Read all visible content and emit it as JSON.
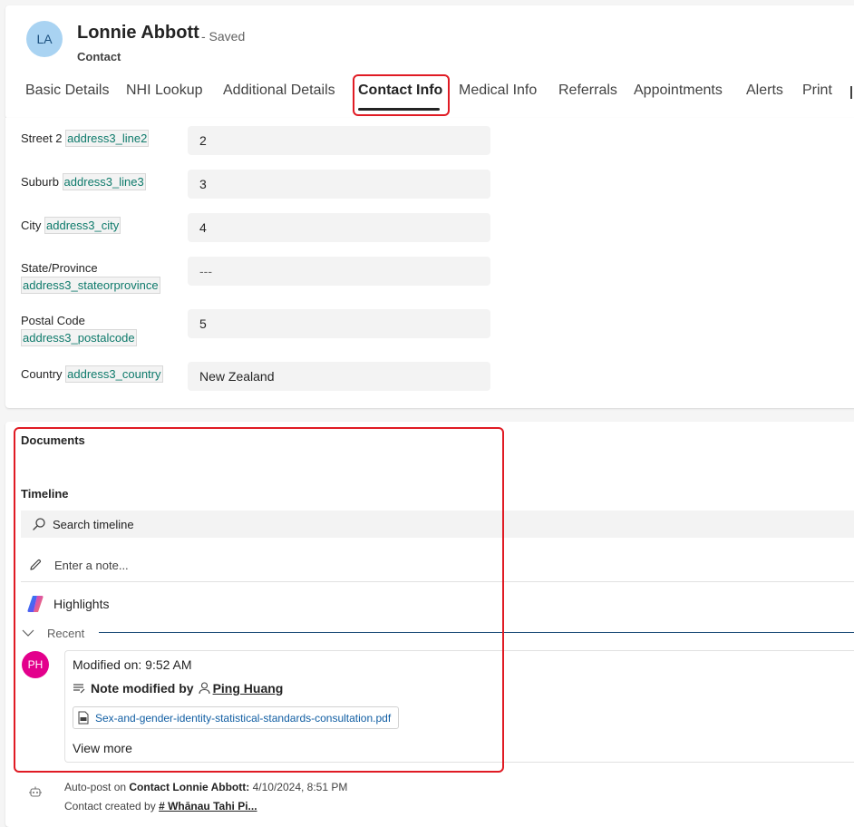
{
  "header": {
    "avatar_initials": "LA",
    "record_name": "Lonnie Abbott",
    "saved_status": "- Saved",
    "entity_type": "Contact"
  },
  "tabs": [
    {
      "label": "Basic Details"
    },
    {
      "label": "NHI Lookup"
    },
    {
      "label": "Additional Details"
    },
    {
      "label": "Contact Info",
      "active": true
    },
    {
      "label": "Medical Info"
    },
    {
      "label": "Referrals"
    },
    {
      "label": "Appointments"
    },
    {
      "label": "Alerts"
    },
    {
      "label": "Print"
    }
  ],
  "address": {
    "fields": [
      {
        "label": "Street 2",
        "schema": "address3_line2",
        "value": "2"
      },
      {
        "label": "Suburb",
        "schema": "address3_line3",
        "value": "3"
      },
      {
        "label": "City",
        "schema": "address3_city",
        "value": "4"
      },
      {
        "label": "State/Province",
        "schema": "address3_stateorprovince",
        "value": "---"
      },
      {
        "label": "Postal Code",
        "schema": "address3_postalcode",
        "value": "5"
      },
      {
        "label": "Country",
        "schema": "address3_country",
        "value": "New Zealand"
      }
    ]
  },
  "documents": {
    "title": "Documents"
  },
  "timeline": {
    "title": "Timeline",
    "search_placeholder": "Search timeline",
    "note_placeholder": "Enter a note...",
    "highlights_label": "Highlights",
    "recent_label": "Recent",
    "activity": {
      "avatar_initials": "PH",
      "modified_on": "Modified on: 9:52 AM",
      "note_label": "Note modified by",
      "author": "Ping Huang",
      "attachment": "Sex-and-gender-identity-statistical-standards-consultation.pdf",
      "view_more": "View more"
    },
    "autopost": {
      "prefix": "Auto-post on",
      "subject": "Contact Lonnie Abbott:",
      "timestamp": "4/10/2024, 8:51 PM",
      "line2_prefix": "Contact created by",
      "line2_link": "# Whānau Tahi Pi..."
    }
  },
  "colors": {
    "accent_red": "#e01b24",
    "avatar_la": "#a9d3f2",
    "avatar_ph": "#e3008c",
    "schema_text": "#0e7a6b",
    "link_blue": "#115ea3"
  }
}
